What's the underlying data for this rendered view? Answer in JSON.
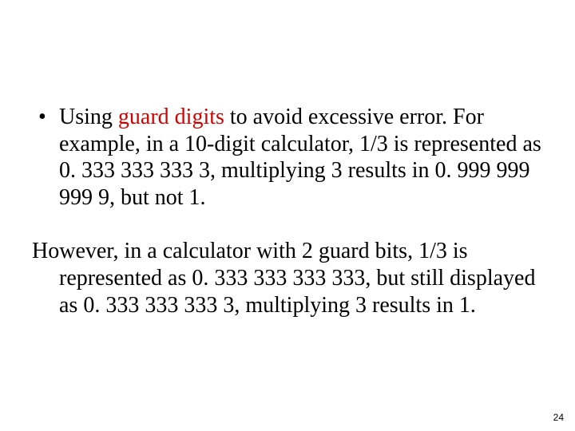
{
  "slide": {
    "bullet": {
      "text_before": "Using ",
      "highlight": "guard digits",
      "text_after": " to avoid excessive error. For example, in a 10-digit calculator, 1/3 is represented as 0. 333 333 333 3, multiplying 3 results in 0. 999 999 999 9, but not 1."
    },
    "para2_first": "However, in a calculator with 2 guard bits, 1/3 is",
    "para2_rest": "represented as 0. 333 333 333 333, but still displayed as 0. 333 333 333 3, multiplying 3 results in 1.",
    "page_number": "24"
  }
}
